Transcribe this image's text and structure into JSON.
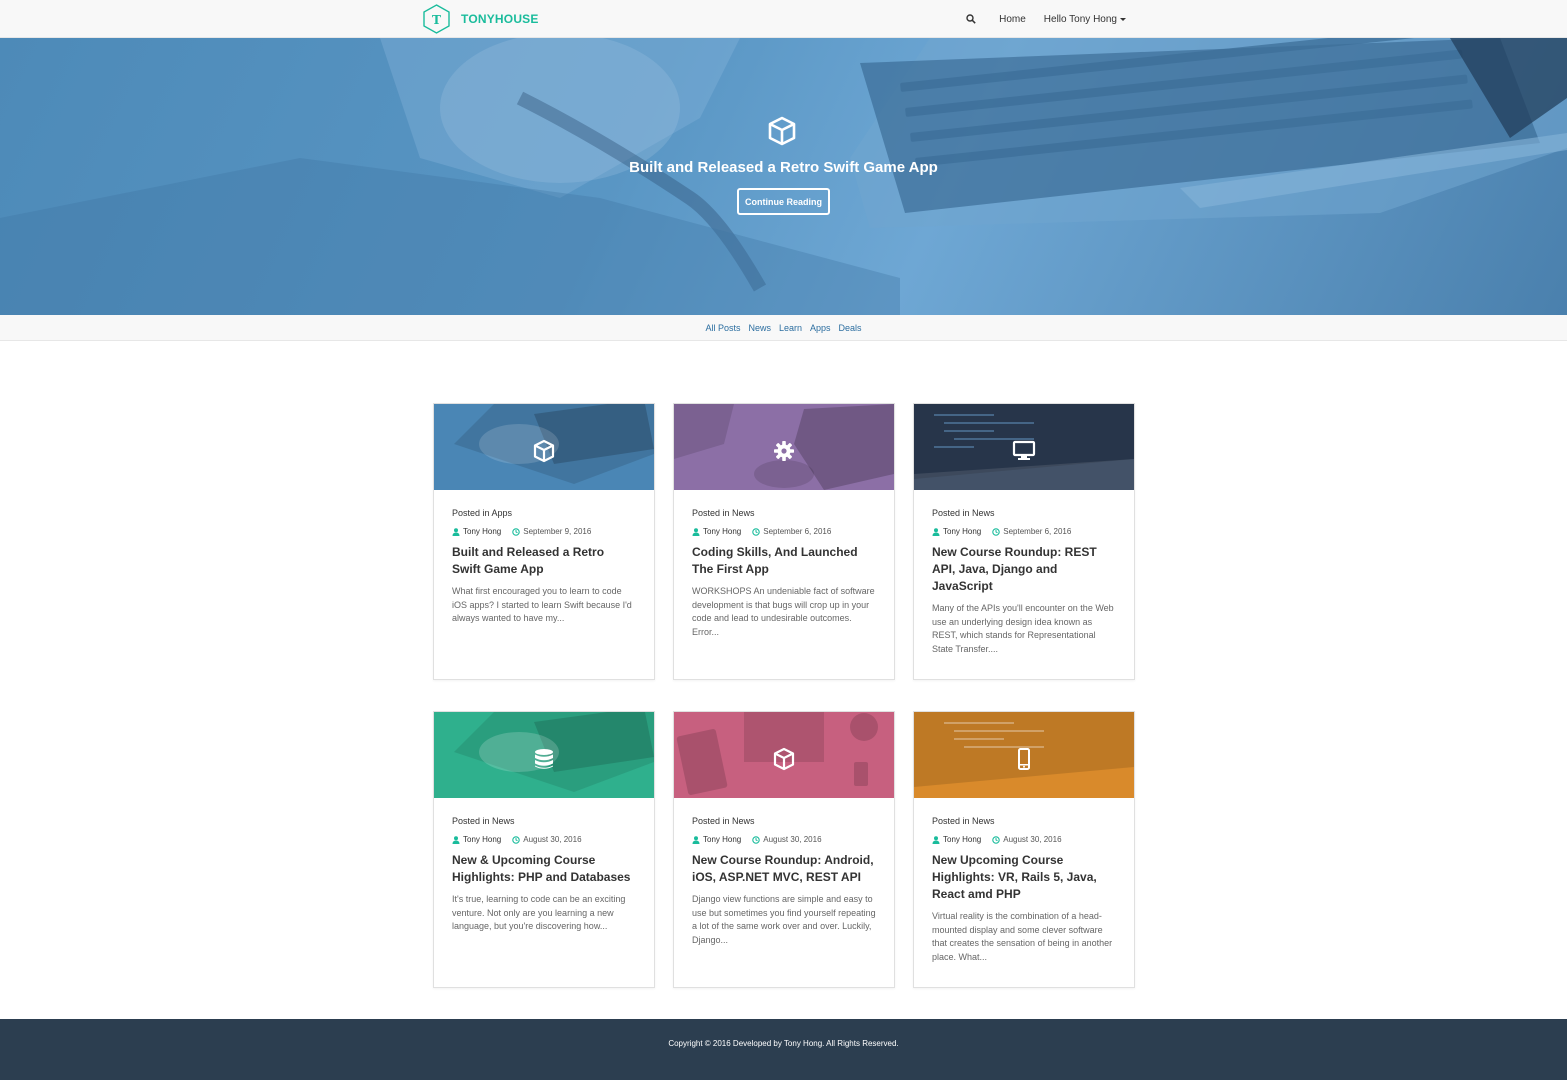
{
  "brand": {
    "name": "TONYHOUSE",
    "logo_letter": "T"
  },
  "nav": {
    "search_icon": "search-icon",
    "home": "Home",
    "user": "Hello Tony Hong"
  },
  "hero": {
    "icon": "cube-icon",
    "title": "Built and Released a Retro Swift Game App",
    "button": "Continue Reading"
  },
  "categories": [
    "All Posts",
    "News",
    "Learn",
    "Apps",
    "Deals"
  ],
  "posts": [
    {
      "posted_prefix": "Posted in ",
      "category": "Apps",
      "author": "Tony Hong",
      "date": "September 9, 2016",
      "title": "Built and Released a Retro Swift Game App",
      "excerpt": "What first encouraged you to learn to code iOS apps? I started to learn Swift because I'd always wanted to have my...",
      "icon": "cube-icon",
      "color": "#4a86b5"
    },
    {
      "posted_prefix": "Posted in ",
      "category": "News",
      "author": "Tony Hong",
      "date": "September 6, 2016",
      "title": "Coding Skills, And Launched The First App",
      "excerpt": "WORKSHOPS An undeniable fact of software development is that bugs will crop up in your code and lead to undesirable outcomes. Error...",
      "icon": "gear-icon",
      "color": "#8c6fa6"
    },
    {
      "posted_prefix": "Posted in ",
      "category": "News",
      "author": "Tony Hong",
      "date": "September 6, 2016",
      "title": "New Course Roundup: REST API, Java, Django and JavaScript",
      "excerpt": "Many of the APIs you'll encounter on the Web use an underlying design idea known as REST, which stands for Representational State Transfer....",
      "icon": "desktop-icon",
      "color": "#2e3f57"
    },
    {
      "posted_prefix": "Posted in ",
      "category": "News",
      "author": "Tony Hong",
      "date": "August 30, 2016",
      "title": "New & Upcoming Course Highlights: PHP and Databases",
      "excerpt": "It's true, learning to code can be an exciting venture. Not only are you learning a new language, but you're discovering how...",
      "icon": "database-icon",
      "color": "#2fb08d"
    },
    {
      "posted_prefix": "Posted in ",
      "category": "News",
      "author": "Tony Hong",
      "date": "August 30, 2016",
      "title": "New Course Roundup: Android, iOS, ASP.NET MVC, REST API",
      "excerpt": "Django view functions are simple and easy to use but sometimes you find yourself repeating a lot of the same work over and over. Luckily, Django...",
      "icon": "cube-icon",
      "color": "#c7607f"
    },
    {
      "posted_prefix": "Posted in ",
      "category": "News",
      "author": "Tony Hong",
      "date": "August 30, 2016",
      "title": "New Upcoming Course Highlights: VR, Rails 5, Java, React amd PHP",
      "excerpt": "Virtual reality is the combination of a head-mounted display and some clever software that creates the sensation of being in another place. What...",
      "icon": "mobile-icon",
      "color": "#d98a2b"
    }
  ],
  "footer": {
    "text": "Copyright © 2016 Developed by Tony Hong. All Rights Reserved."
  },
  "colors": {
    "accent": "#1abc9c",
    "footer_bg": "#2c3e50",
    "link": "#2c6ea0"
  }
}
